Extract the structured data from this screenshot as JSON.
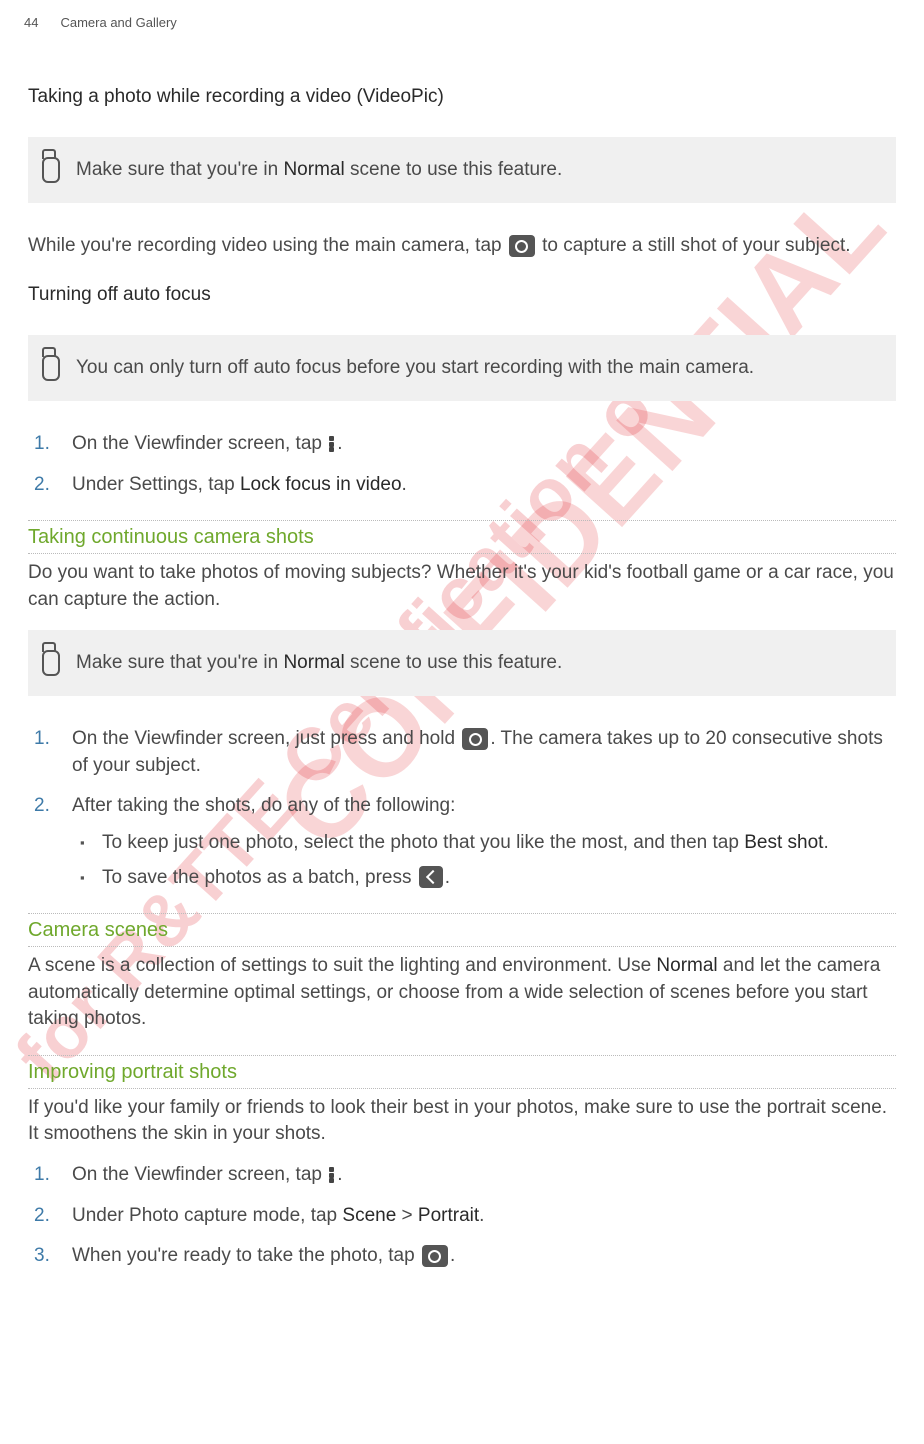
{
  "page": {
    "number": "44",
    "header": "Camera and Gallery"
  },
  "videopic": {
    "heading": "Taking a photo while recording a video (VideoPic)",
    "note": {
      "pre": "Make sure that you're in ",
      "bold": "Normal",
      "post": " scene to use this feature."
    },
    "body": {
      "pre": "While you're recording video using the main camera, tap ",
      "post": " to capture a still shot of your subject."
    }
  },
  "autofocus": {
    "heading": "Turning off auto focus",
    "note": "You can only turn off auto focus before you start recording with the main camera.",
    "steps": {
      "s1": {
        "pre": "On the Viewfinder screen, tap ",
        "post": "."
      },
      "s2": {
        "pre": "Under Settings, tap ",
        "bold": "Lock focus in video",
        "post": "."
      }
    }
  },
  "continuous": {
    "heading": "Taking continuous camera shots",
    "intro": "Do you want to take photos of moving subjects? Whether it's your kid's football game or a car race, you can capture the action.",
    "note": {
      "pre": "Make sure that you're in ",
      "bold": "Normal",
      "post": " scene to use this feature."
    },
    "steps": {
      "s1": {
        "pre": "On the Viewfinder screen, just press and hold ",
        "post": ". The camera takes up to 20 consecutive shots of your subject."
      },
      "s2": "After taking the shots, do any of the following:",
      "b1": {
        "pre": "To keep just one photo, select the photo that you like the most, and then tap ",
        "bold": "Best shot",
        "post": "."
      },
      "b2": {
        "pre": "To save the photos as a batch, press ",
        "post": "."
      }
    }
  },
  "scenes": {
    "heading": "Camera scenes",
    "body": {
      "pre": "A scene is a collection of settings to suit the lighting and environment. Use ",
      "bold": "Normal",
      "post": " and let the camera automatically determine optimal settings, or choose from a wide selection of scenes before you start taking photos."
    }
  },
  "portrait": {
    "heading": "Improving portrait shots",
    "intro": "If you'd like your family or friends to look their best in your photos, make sure to use the portrait scene. It smoothens the skin in your shots.",
    "steps": {
      "s1": {
        "pre": "On the Viewfinder screen, tap ",
        "post": "."
      },
      "s2": {
        "pre": "Under Photo capture mode, tap ",
        "bold1": "Scene",
        "mid": " > ",
        "bold2": "Portrait",
        "post": "."
      },
      "s3": {
        "pre": "When you're ready to take the photo, tap ",
        "post": "."
      }
    }
  }
}
